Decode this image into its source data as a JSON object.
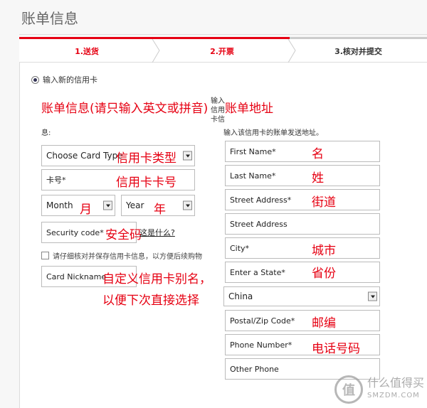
{
  "page": {
    "title": "账单信息"
  },
  "steps": [
    {
      "label": "1.送货"
    },
    {
      "label": "2.开票"
    },
    {
      "label": "3.核对并提交"
    }
  ],
  "payment": {
    "new_card_label": "输入新的信用卡"
  },
  "billing_info": {
    "heading_annotation": "账单信息(请只输入英文或拼音)",
    "input_label": "输入信用卡信",
    "input_label_tail": "息:",
    "card_type": {
      "value": "Choose Card Type",
      "annotation": "信用卡类型"
    },
    "card_number": {
      "placeholder": "卡号*",
      "annotation": "信用卡卡号"
    },
    "month": {
      "value": "Month",
      "annotation": "月"
    },
    "year": {
      "value": "Year",
      "annotation": "年"
    },
    "security_code": {
      "placeholder": "Security code*",
      "annotation": "安全码",
      "help_link": "这是什么?"
    },
    "save_card_label": "请仔细核对并保存信用卡信息，以方便后续购物",
    "nickname": {
      "placeholder": "Card Nickname",
      "annotation_line1": "自定义信用卡别名，",
      "annotation_line2": "以便下次直接选择"
    }
  },
  "billing_address": {
    "heading_annotation": "账单地址",
    "input_label": "输入该信用卡的账单发送地址。",
    "first_name": {
      "placeholder": "First Name*",
      "annotation": "名"
    },
    "last_name": {
      "placeholder": "Last Name*",
      "annotation": "姓"
    },
    "street1": {
      "placeholder": "Street Address*",
      "annotation": "街道"
    },
    "street2": {
      "placeholder": "Street Address"
    },
    "city": {
      "placeholder": "City*",
      "annotation": "城市"
    },
    "state": {
      "placeholder": "Enter a State*",
      "annotation": "省份"
    },
    "country": {
      "value": "China"
    },
    "postal": {
      "placeholder": "Postal/Zip Code*",
      "annotation": "邮编"
    },
    "phone": {
      "placeholder": "Phone Number*",
      "annotation": "电话号码"
    },
    "other_phone": {
      "placeholder": "Other Phone"
    }
  },
  "watermark": {
    "badge": "值",
    "line1": "什么值得买",
    "line2": "SMZDM.COM"
  },
  "colors": {
    "accent": "#e60012",
    "annotation": "#e60012"
  }
}
